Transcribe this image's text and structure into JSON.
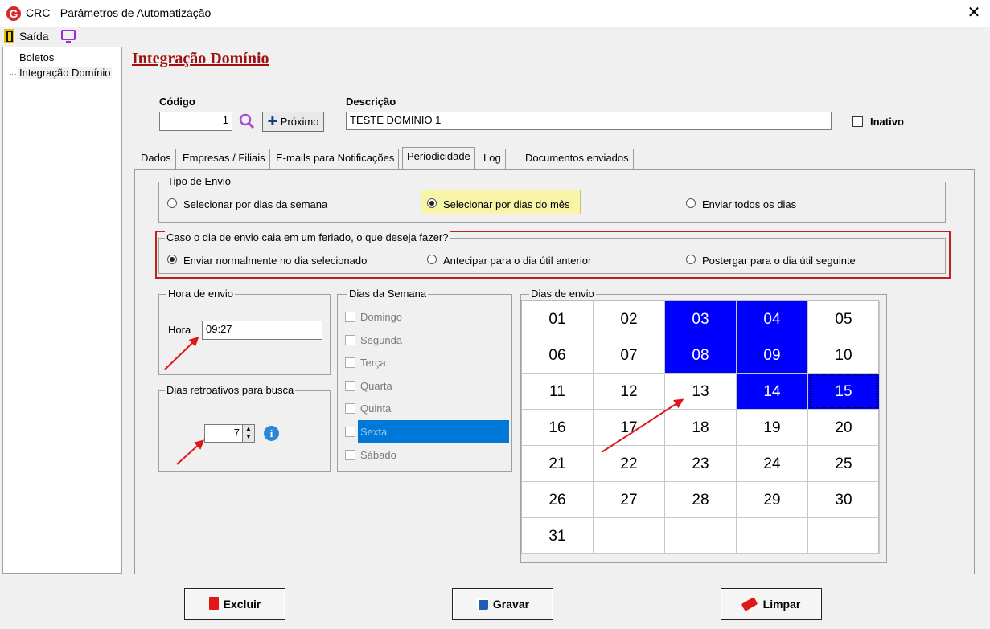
{
  "window": {
    "title": "CRC - Parâmetros de Automatização",
    "close": "✕"
  },
  "menu": {
    "exit_label": "Saída"
  },
  "tree": {
    "items": [
      "Boletos",
      "Integração Domínio"
    ]
  },
  "page": {
    "title": "Integração Domínio"
  },
  "code": {
    "label": "Código",
    "value": "1",
    "next_label": "Próximo"
  },
  "description": {
    "label": "Descrição",
    "value": "TESTE DOMINIO 1"
  },
  "inactive": {
    "label": "Inativo",
    "checked": false
  },
  "tabs": [
    "Dados",
    "Empresas / Filiais",
    "E-mails para Notificações",
    "Periodicidade",
    "Log",
    "Documentos enviados"
  ],
  "active_tab": "Periodicidade",
  "send_type": {
    "title": "Tipo de Envio",
    "options": [
      "Selecionar por dias da semana",
      "Selecionar por dias do mês",
      "Enviar todos os dias"
    ],
    "selected": "Selecionar por dias do mês"
  },
  "holiday": {
    "title": "Caso o dia de envio caia em um feriado, o que deseja fazer?",
    "options": [
      "Enviar normalmente no dia selecionado",
      "Antecipar para o dia útil anterior",
      "Postergar para o dia útil seguinte"
    ],
    "selected": "Enviar normalmente no dia selecionado"
  },
  "send_time": {
    "title": "Hora de envio",
    "label": "Hora",
    "value": "09:27"
  },
  "lookback": {
    "title": "Dias retroativos para busca",
    "value": "7"
  },
  "weekdays": {
    "title": "Dias da Semana",
    "items": [
      "Domingo",
      "Segunda",
      "Terça",
      "Quarta",
      "Quinta",
      "Sexta",
      "Sábado"
    ],
    "highlighted": "Sexta"
  },
  "send_days": {
    "title": "Dias de envio",
    "days": [
      "01",
      "02",
      "03",
      "04",
      "05",
      "06",
      "07",
      "08",
      "09",
      "10",
      "11",
      "12",
      "13",
      "14",
      "15",
      "16",
      "17",
      "18",
      "19",
      "20",
      "21",
      "22",
      "23",
      "24",
      "25",
      "26",
      "27",
      "28",
      "29",
      "30",
      "31"
    ],
    "selected": [
      "03",
      "04",
      "08",
      "09",
      "14",
      "15"
    ],
    "focused": "15"
  },
  "buttons": {
    "delete": "Excluir",
    "save": "Gravar",
    "clear": "Limpar"
  },
  "colors": {
    "title_red": "#a01010",
    "selected_blue": "#0000ff",
    "highlight_box": "#c02020",
    "arrow_red": "#e0151a"
  }
}
